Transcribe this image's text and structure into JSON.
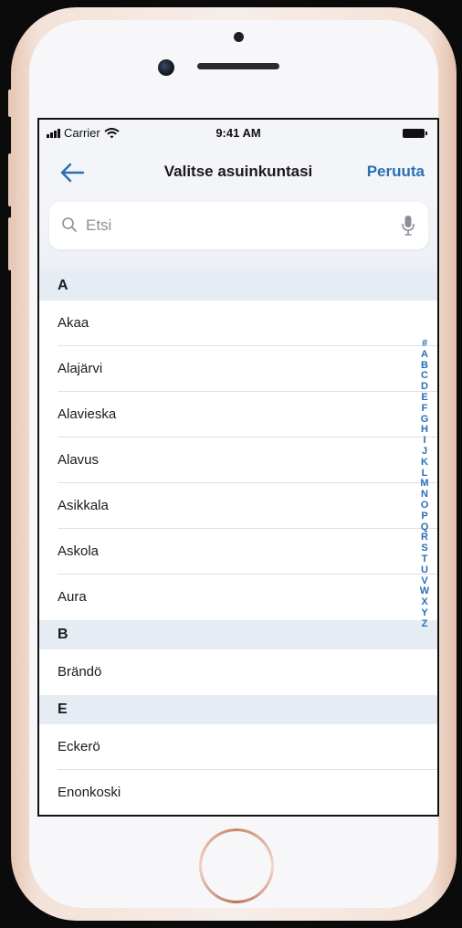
{
  "status_bar": {
    "carrier": "Carrier",
    "time": "9:41 AM"
  },
  "nav": {
    "back_icon": "arrow-left-icon",
    "title": "Valitse asuinkuntasi",
    "action": "Peruuta"
  },
  "search": {
    "placeholder": "Etsi",
    "value": "",
    "icons": [
      "search-icon",
      "microphone-icon"
    ]
  },
  "sections": [
    {
      "letter": "A",
      "items": [
        "Akaa",
        "Alajärvi",
        "Alavieska",
        "Alavus",
        "Asikkala",
        "Askola",
        "Aura"
      ]
    },
    {
      "letter": "B",
      "items": [
        "Brändö"
      ]
    },
    {
      "letter": "E",
      "items": [
        "Eckerö",
        "Enonkoski"
      ]
    }
  ],
  "index_letters": [
    "#",
    "A",
    "B",
    "C",
    "D",
    "E",
    "F",
    "G",
    "H",
    "I",
    "J",
    "K",
    "L",
    "M",
    "N",
    "O",
    "P",
    "Q",
    "R",
    "S",
    "T",
    "U",
    "V",
    "W",
    "X",
    "Y",
    "Z"
  ],
  "colors": {
    "accent": "#2a6fb2",
    "section_bg": "#e6ecf4",
    "header_bg": "#f3f5f9"
  }
}
